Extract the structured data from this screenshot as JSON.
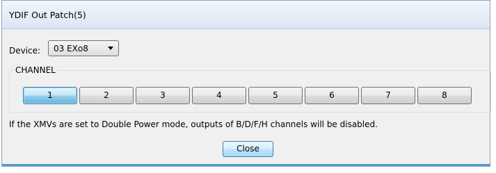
{
  "window": {
    "title": "YDIF Out Patch(5)"
  },
  "device": {
    "label": "Device:",
    "selected": "03 EXo8"
  },
  "channel_group": {
    "legend": "CHANNEL",
    "buttons": [
      "1",
      "2",
      "3",
      "4",
      "5",
      "6",
      "7",
      "8"
    ],
    "selected_index": 0
  },
  "info": {
    "text": "If the XMVs are set to Double Power mode, outputs of  B/D/F/H channels will be disabled."
  },
  "actions": {
    "close_label": "Close"
  },
  "colors": {
    "selected_button": "#98d1ef",
    "accent_border": "#3c7fb1"
  }
}
